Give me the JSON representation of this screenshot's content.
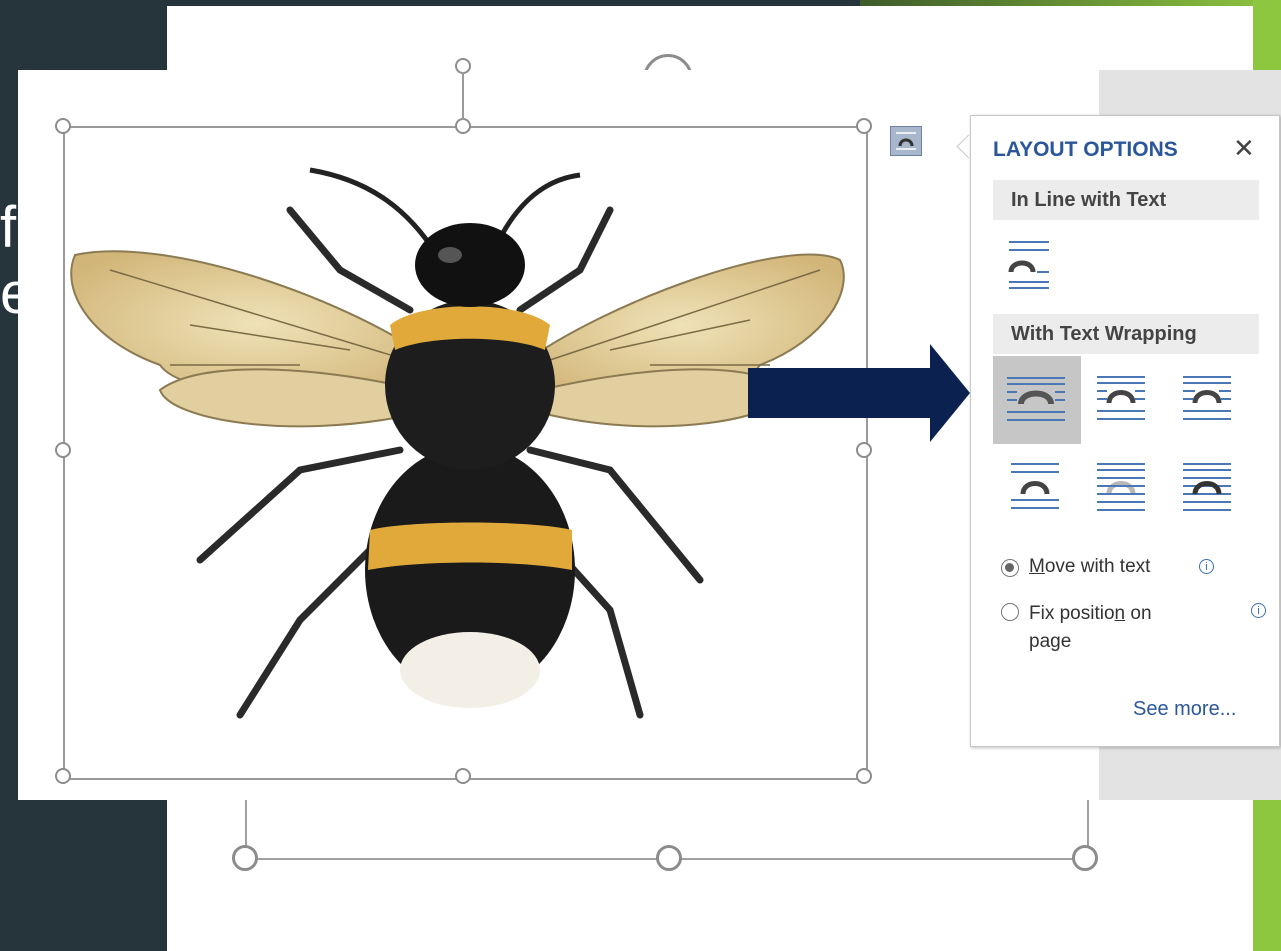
{
  "slide": {
    "left_text": "f\ne)",
    "colors": {
      "background": "#26353b",
      "accent": "#8dc63f",
      "arrow": "#0b2150"
    }
  },
  "image": {
    "subject_icon": "bumblebee-image"
  },
  "layout_options": {
    "title": "LAYOUT OPTIONS",
    "close_glyph": "✕",
    "anchor_icon": "layout-options-icon",
    "inline_section": "In Line with Text",
    "wrapping_section": "With Text Wrapping",
    "wrap_icons": [
      "square-wrap-icon",
      "tight-wrap-icon",
      "through-wrap-icon",
      "top-bottom-wrap-icon",
      "behind-text-icon",
      "in-front-of-text-icon"
    ],
    "selected_wrap": "square-wrap-icon",
    "move_with_text": {
      "label_prefix": "",
      "mnemonic": "M",
      "label_rest": "ove with text",
      "checked": true
    },
    "fix_position": {
      "label_line1_a": "Fix positio",
      "mnemonic": "n",
      "label_line1_b": " on",
      "label_line2": "page",
      "checked": false
    },
    "info_glyph": "i",
    "see_more": "See more..."
  }
}
